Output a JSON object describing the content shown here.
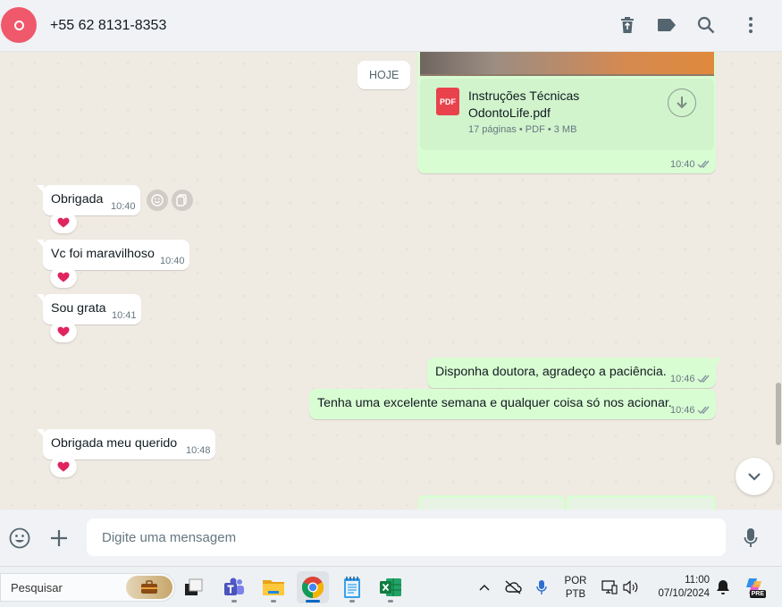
{
  "header": {
    "contact_name": "+55 62 8131-8353",
    "icons": [
      "delete-icon",
      "label-icon",
      "search-icon",
      "menu-icon"
    ]
  },
  "chat": {
    "date_chip": "HOJE",
    "document": {
      "name": "Instruções Técnicas OdontoLife.pdf",
      "pdf_badge": "PDF",
      "meta": "17 páginas • PDF • 3 MB",
      "time": "10:40"
    },
    "messages": [
      {
        "direction": "in",
        "text": "Obrigada",
        "time": "10:40",
        "reaction": "heart"
      },
      {
        "direction": "in",
        "text": "Vc foi maravilhoso",
        "time": "10:40",
        "reaction": "heart"
      },
      {
        "direction": "in",
        "text": "Sou grata",
        "time": "10:41",
        "reaction": "heart"
      },
      {
        "direction": "out",
        "text": "Disponha doutora, agradeço a paciência.",
        "time": "10:46",
        "status": "read"
      },
      {
        "direction": "out",
        "text": "Tenha uma excelente semana e qualquer coisa só nos acionar.",
        "time": "10:46",
        "status": "read"
      },
      {
        "direction": "in",
        "text": "Obrigada meu querido",
        "time": "10:48",
        "reaction": "heart"
      }
    ]
  },
  "composer": {
    "placeholder": "Digite uma mensagem"
  },
  "taskbar": {
    "search_placeholder": "Pesquisar",
    "apps": [
      "briefcase-icon",
      "taskview-icon",
      "teams-icon",
      "file-explorer-icon",
      "chrome-icon",
      "notepad-icon",
      "excel-icon"
    ],
    "language_line1": "POR",
    "language_line2": "PTB",
    "time": "11:00",
    "date": "07/10/2024",
    "copilot_badge": "PRE",
    "colors": {
      "accent": "#0067c0",
      "bubble_out": "#d9fdd3",
      "bubble_in": "#ffffff",
      "heart": "#e0245e"
    }
  }
}
